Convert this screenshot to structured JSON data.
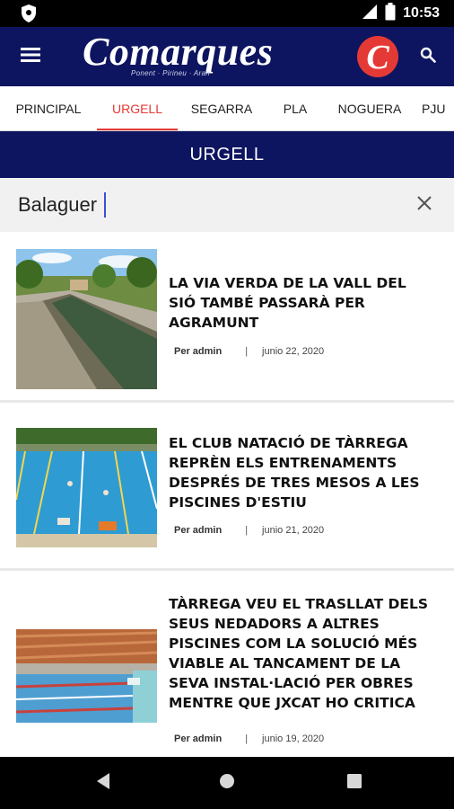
{
  "status_bar": {
    "time": "10:53",
    "icons": [
      "shield-icon",
      "signal-icon",
      "battery-icon"
    ]
  },
  "app_bar": {
    "logo_text": "Comarques",
    "logo_subtitle": "Ponent · Pirineu · Aran",
    "brand_letter": "C",
    "icons": [
      "menu-icon",
      "search-icon"
    ],
    "colors": {
      "primary": "#0d1560",
      "accent": "#e53935"
    }
  },
  "tabs": [
    {
      "label": "PRINCIPAL",
      "active": false
    },
    {
      "label": "URGELL",
      "active": true
    },
    {
      "label": "SEGARRA",
      "active": false
    },
    {
      "label": "PLA",
      "active": false
    },
    {
      "label": "NOGUERA",
      "active": false
    },
    {
      "label": "PJU",
      "active": false
    }
  ],
  "section": {
    "title": "URGELL"
  },
  "search": {
    "value": "Balaguer",
    "clear_icon": "close-icon"
  },
  "articles": [
    {
      "title": "LA VIA VERDA DE LA VALL DEL SIÓ TAMBÉ PASSARÀ PER AGRAMUNT",
      "author": "Per admin",
      "separator": "|",
      "date": "junio 22, 2020",
      "image": "canal-photo"
    },
    {
      "title": "EL CLUB NATACIÓ DE TÀRREGA REPRÈN ELS ENTRENAMENTS DESPRÉS DE TRES MESOS A LES PISCINES D'ESTIU",
      "author": "Per admin",
      "separator": "|",
      "date": "junio 21, 2020",
      "image": "outdoor-pool-photo"
    },
    {
      "title": "TÀRREGA VEU EL TRASLLAT DELS SEUS NEDADORS A ALTRES PISCINES COM LA SOLUCIÓ MÉS VIABLE AL TANCAMENT DE LA SEVA INSTAL·LACIÓ PER OBRES MENTRE QUE JXCAT HO CRITICA",
      "author": "Per admin",
      "separator": "|",
      "date": "junio 19, 2020",
      "image": "indoor-pool-photo"
    }
  ],
  "nav_bar": {
    "icons": [
      "back-icon",
      "home-icon",
      "recents-icon"
    ]
  }
}
